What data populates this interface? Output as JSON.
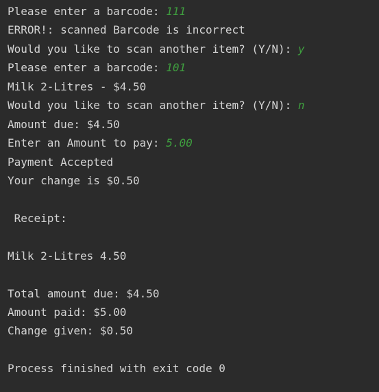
{
  "console": {
    "lines": [
      {
        "text": "Please enter a barcode: ",
        "input": "111"
      },
      {
        "text": "ERROR!: scanned Barcode is incorrect",
        "input": ""
      },
      {
        "text": "Would you like to scan another item? (Y/N): ",
        "input": "y"
      },
      {
        "text": "Please enter a barcode: ",
        "input": "101"
      },
      {
        "text": "Milk 2-Litres - $4.50",
        "input": ""
      },
      {
        "text": "Would you like to scan another item? (Y/N): ",
        "input": "n"
      },
      {
        "text": "Amount due: $4.50",
        "input": ""
      },
      {
        "text": "Enter an Amount to pay: ",
        "input": "5.00"
      },
      {
        "text": "Payment Accepted",
        "input": ""
      },
      {
        "text": "Your change is $0.50",
        "input": ""
      },
      {
        "text": "",
        "input": ""
      },
      {
        "text": " Receipt:",
        "input": ""
      },
      {
        "text": "",
        "input": ""
      },
      {
        "text": "Milk 2-Litres 4.50",
        "input": ""
      },
      {
        "text": "",
        "input": ""
      },
      {
        "text": "Total amount due: $4.50",
        "input": ""
      },
      {
        "text": "Amount paid: $5.00",
        "input": ""
      },
      {
        "text": "Change given: $0.50",
        "input": ""
      },
      {
        "text": "",
        "input": ""
      },
      {
        "text": "Process finished with exit code 0",
        "input": ""
      }
    ]
  },
  "colors": {
    "background": "#2b2b2b",
    "output_text": "#d4d4d4",
    "user_input": "#3f9f3f"
  }
}
